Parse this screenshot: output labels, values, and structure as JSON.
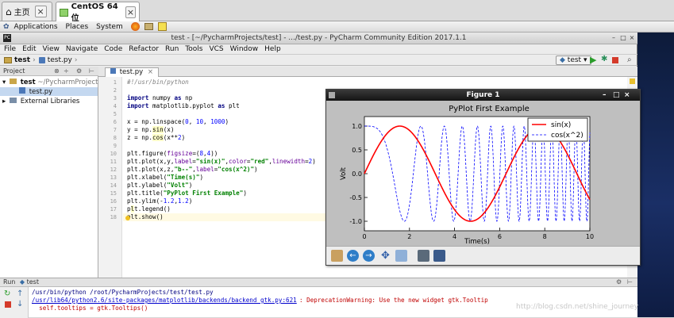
{
  "vm_tabs": [
    {
      "label": "主页"
    },
    {
      "label": "CentOS 64 位"
    }
  ],
  "gnome": {
    "applications": "Applications",
    "places": "Places",
    "system": "System"
  },
  "window": {
    "title": "test - [~/PycharmProjects/test] - .../test.py - PyCharm Community Edition 2017.1.1"
  },
  "menu": [
    "File",
    "Edit",
    "View",
    "Navigate",
    "Code",
    "Refactor",
    "Run",
    "Tools",
    "VCS",
    "Window",
    "Help"
  ],
  "nav": {
    "project": "test",
    "file": "test.py",
    "run_config": "test"
  },
  "project_panel": {
    "header": "Project",
    "root": "test",
    "root_path": "~/PycharmProjects/t",
    "file": "test.py",
    "libs": "External Libraries"
  },
  "editor": {
    "tab": "test.py",
    "line_numbers": [
      "1",
      "2",
      "3",
      "4",
      "5",
      "6",
      "7",
      "8",
      "9",
      "10",
      "11",
      "12",
      "13",
      "14",
      "15",
      "16",
      "17",
      "18"
    ]
  },
  "figure": {
    "title": "Figure 1",
    "chart_data": {
      "type": "line",
      "title": "PyPlot First Example",
      "xlabel": "Time(s)",
      "ylabel": "Volt",
      "xlim": [
        0,
        10
      ],
      "ylim": [
        -1.2,
        1.2
      ],
      "x_ticks": [
        "0",
        "2",
        "4",
        "6",
        "8",
        "10"
      ],
      "y_ticks": [
        "1.0",
        "0.5",
        "0.0",
        "-0.5",
        "-1.0"
      ],
      "legend_position": "top-right",
      "series": [
        {
          "name": "sin(x)",
          "function": "sin(x)",
          "color": "#ff0000",
          "style": "solid"
        },
        {
          "name": "cos(x^2)",
          "function": "cos(x^2)",
          "color": "#0000ff",
          "style": "dashed"
        }
      ]
    }
  },
  "run": {
    "header": "Run",
    "config": "test",
    "lines": [
      "/usr/bin/python /root/PycharmProjects/test/test.py",
      "/usr/lib64/python2.6/site-packages/matplotlib/backends/backend_gtk.py:621",
      ": DeprecationWarning: Use the new widget gtk.Tooltip",
      "  self.tooltips = gtk.Tooltips()"
    ]
  },
  "watermark": "http://blog.csdn.net/shine_journey",
  "colors": {
    "sin": "#ff0000",
    "cos": "#0000ff",
    "keyword": "#000080",
    "string": "#008000",
    "number": "#0000ff"
  }
}
